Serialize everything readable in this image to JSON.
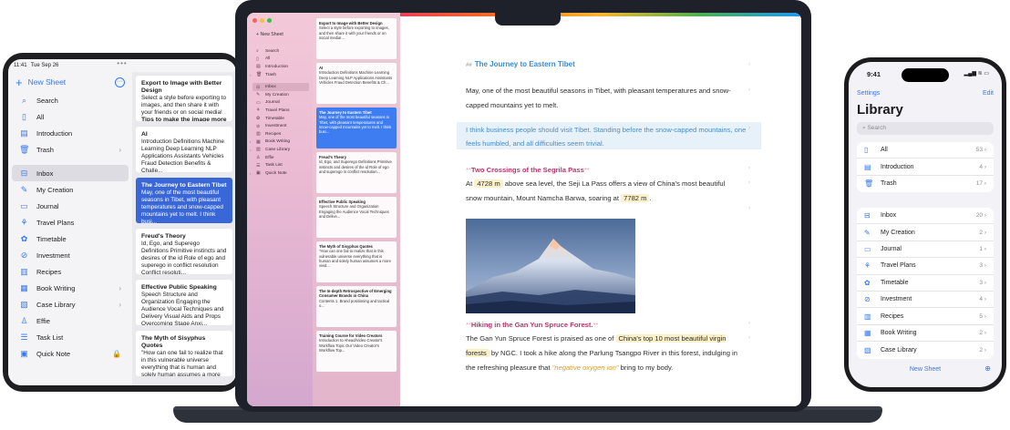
{
  "ipad": {
    "status_time": "11:41",
    "status_date": "Tue Sep 26",
    "status_dots": "•••",
    "new_sheet": "New Sheet",
    "sidebar": [
      {
        "label": "Search",
        "icon": "search-icon",
        "glyph": "⌕"
      },
      {
        "label": "All",
        "icon": "all-icon",
        "glyph": "▯"
      },
      {
        "label": "Introduction",
        "icon": "introduction-icon",
        "glyph": "▤"
      },
      {
        "label": "Trash",
        "icon": "trash-icon",
        "glyph": "🗑",
        "chevron": "›"
      },
      {
        "label": "Inbox",
        "icon": "inbox-icon",
        "glyph": "⊟",
        "selected": true
      },
      {
        "label": "My Creation",
        "icon": "pen-icon",
        "glyph": "✎"
      },
      {
        "label": "Journal",
        "icon": "journal-icon",
        "glyph": "▭"
      },
      {
        "label": "Travel Plans",
        "icon": "travel-icon",
        "glyph": "⚘"
      },
      {
        "label": "Timetable",
        "icon": "timetable-icon",
        "glyph": "✿"
      },
      {
        "label": "Investment",
        "icon": "investment-icon",
        "glyph": "⊘"
      },
      {
        "label": "Recipes",
        "icon": "recipes-icon",
        "glyph": "▥"
      },
      {
        "label": "Book Writing",
        "icon": "book-icon",
        "glyph": "▦",
        "chevron": "›"
      },
      {
        "label": "Case Library",
        "icon": "library-icon",
        "glyph": "▧",
        "chevron": "›"
      },
      {
        "label": "Effie",
        "icon": "person-icon",
        "glyph": "♙"
      },
      {
        "label": "Task List",
        "icon": "task-icon",
        "glyph": "☰"
      },
      {
        "label": "Quick Note",
        "icon": "quicknote-icon",
        "glyph": "▣",
        "chevron": "🔒"
      }
    ],
    "cards": [
      {
        "title": "Export to Image with Better Design",
        "body": "Select a style before exporting to images, and then share it with your friends or on social media!",
        "extra": "Tips to make the image more aes..."
      },
      {
        "title": "AI",
        "body": "Introduction Definitions  Machine Learning Deep Learning NLP Applications Assistants Vehicles Fraud Detection  Benefits & Challe..."
      },
      {
        "title": "The Journey to Eastern Tibet",
        "body": "May, one of the most beautiful seasons in Tibet, with pleasant temperatures and snow-capped mountains yet to melt. I think busi...",
        "selected": true
      },
      {
        "title": "Freud's Theory",
        "body": "Id, Ego, and Superego Definitions Primitive instincts and desires of the id Role of ego and superego in conflict resolution Conflict resoluti..."
      },
      {
        "title": "Effective Public Speaking",
        "body": "Speech Structure and Organization Engaging the Audience Vocal Techniques and Delivery Visual Aids and Props Overcoming Stage Anxi..."
      },
      {
        "title": "The Myth of Sisyphus Quotes",
        "body": "\"How can one fail to realize that in this vulnerable universe everything that is human and solely human assumes a more vivid meaning?\""
      }
    ]
  },
  "mac": {
    "new_sheet": "New Sheet",
    "sidebar": [
      {
        "label": "Search",
        "glyph": "⌕"
      },
      {
        "label": "All",
        "glyph": "▯"
      },
      {
        "label": "Introduction",
        "glyph": "▤"
      },
      {
        "label": "Trash",
        "glyph": "🗑",
        "arrow": "›"
      },
      {
        "label": "Inbox",
        "glyph": "⊟",
        "selected": true
      },
      {
        "label": "My Creation",
        "glyph": "✎"
      },
      {
        "label": "Journal",
        "glyph": "▭"
      },
      {
        "label": "Travel Plans",
        "glyph": "⚘"
      },
      {
        "label": "Timetable",
        "glyph": "✿"
      },
      {
        "label": "Investment",
        "glyph": "⊘"
      },
      {
        "label": "Recipes",
        "glyph": "▥"
      },
      {
        "label": "Book Writing",
        "glyph": "▦",
        "arrow": "›"
      },
      {
        "label": "Case Library",
        "glyph": "▧",
        "arrow": "›"
      },
      {
        "label": "Effie",
        "glyph": "♙"
      },
      {
        "label": "Task List",
        "glyph": "☰"
      },
      {
        "label": "Quick Note",
        "glyph": "▣",
        "arrow": "›"
      }
    ],
    "cards": [
      {
        "title": "Export to Image with Better Design",
        "body": "Select a style before exporting to images, and then share it with your friends or on social media!..."
      },
      {
        "title": "AI",
        "body": "Introduction Definitions  Machine Learning Deep Learning NLP Applications Assistants Vehicles Fraud Detection  Benefits & Ch..."
      },
      {
        "title": "The Journey to Eastern Tibet",
        "body": "May, one of the most beautiful seasons in Tibet, with pleasant temperatures and snow-capped mountains yet to melt. I think busi...",
        "selected": true
      },
      {
        "title": "Freud's Theory",
        "body": "Id, Ego, and Superego Definitions Primitive instincts and desires of the id Role of ego and superego in conflict resolution..."
      },
      {
        "title": "Effective Public Speaking",
        "body": "Speech Structure and Organization Engaging the Audience Vocal Techniques and Delive..."
      },
      {
        "title": "The Myth of Sisyphus Quotes",
        "body": "\"How can one fail to realize that in this vulnerable universe everything that is human and solely human assumes a more vivid..."
      },
      {
        "title": "The In-depth Retrospective of Emerging Consumer Brands in China",
        "body": "Contents 1. Brand positioning and tactical o..."
      },
      {
        "title": "Training Course for Video Creators",
        "body": "Introduction to Ahead/Video Creator's Workflow Topic Our Video Creator's Workflow Top..."
      }
    ],
    "editor": {
      "title_hash": "##",
      "title": "The Journey to Eastern Tibet",
      "p1": "May, one of the most beautiful seasons in Tibet, with pleasant temperatures and snow-capped mountains yet to melt.",
      "quote": "I think business people should visit Tibet. Standing before the snow-capped mountains, one feels humbled, and all difficulties seem trivial.",
      "h2a_mark": "**",
      "h2a": "Two Crossings of the Segrila Pass",
      "p2_a": "At",
      "p2_hl1": "4728 m",
      "p2_b": "above sea level, the Seji La Pass offers a view of China's most beautiful snow mountain, Mount Namcha Barwa, soaring at",
      "p2_hl2": "7782 m",
      "p2_c": ".",
      "h2b": "Hiking in the Gan Yun Spruce Forest.",
      "p3_a": "The Gan Yun Spruce Forest is praised as one of",
      "p3_hl": "China's top 10 most beautiful virgin forests",
      "p3_b": "by NGC. I took a hike along the Parlung Tsangpo River in this forest, indulging in the refreshing pleasure that",
      "p3_ital": "\"negative oxygen ion\"",
      "p3_c": "bring to my body.",
      "image_alt": "snow-capped mountain peak at sunset"
    }
  },
  "iphone": {
    "time": "9:41",
    "signal": "▂▄▆ ≋ ▭",
    "settings": "Settings",
    "edit": "Edit",
    "title": "Library",
    "search": "Search",
    "group1": [
      {
        "label": "All",
        "count": "53",
        "glyph": "▯"
      },
      {
        "label": "Introduction",
        "count": "4",
        "glyph": "▤"
      },
      {
        "label": "Trash",
        "count": "17",
        "glyph": "🗑"
      }
    ],
    "group2": [
      {
        "label": "Inbox",
        "count": "20",
        "glyph": "⊟"
      },
      {
        "label": "My Creation",
        "count": "2",
        "glyph": "✎"
      },
      {
        "label": "Journal",
        "count": "1",
        "glyph": "▭"
      },
      {
        "label": "Travel Plans",
        "count": "3",
        "glyph": "⚘"
      },
      {
        "label": "Timetable",
        "count": "3",
        "glyph": "✿"
      },
      {
        "label": "Investment",
        "count": "4",
        "glyph": "⊘"
      },
      {
        "label": "Recipes",
        "count": "5",
        "glyph": "▥"
      },
      {
        "label": "Book Writing",
        "count": "2",
        "glyph": "▦"
      },
      {
        "label": "Case Library",
        "count": "2",
        "glyph": "▧"
      }
    ],
    "new_sheet": "New Sheet"
  },
  "colors": {
    "accent": "#3478f6",
    "selection": "#3a67d8",
    "heading_pink": "#c0306a",
    "title_blue": "#3a8bd6"
  }
}
